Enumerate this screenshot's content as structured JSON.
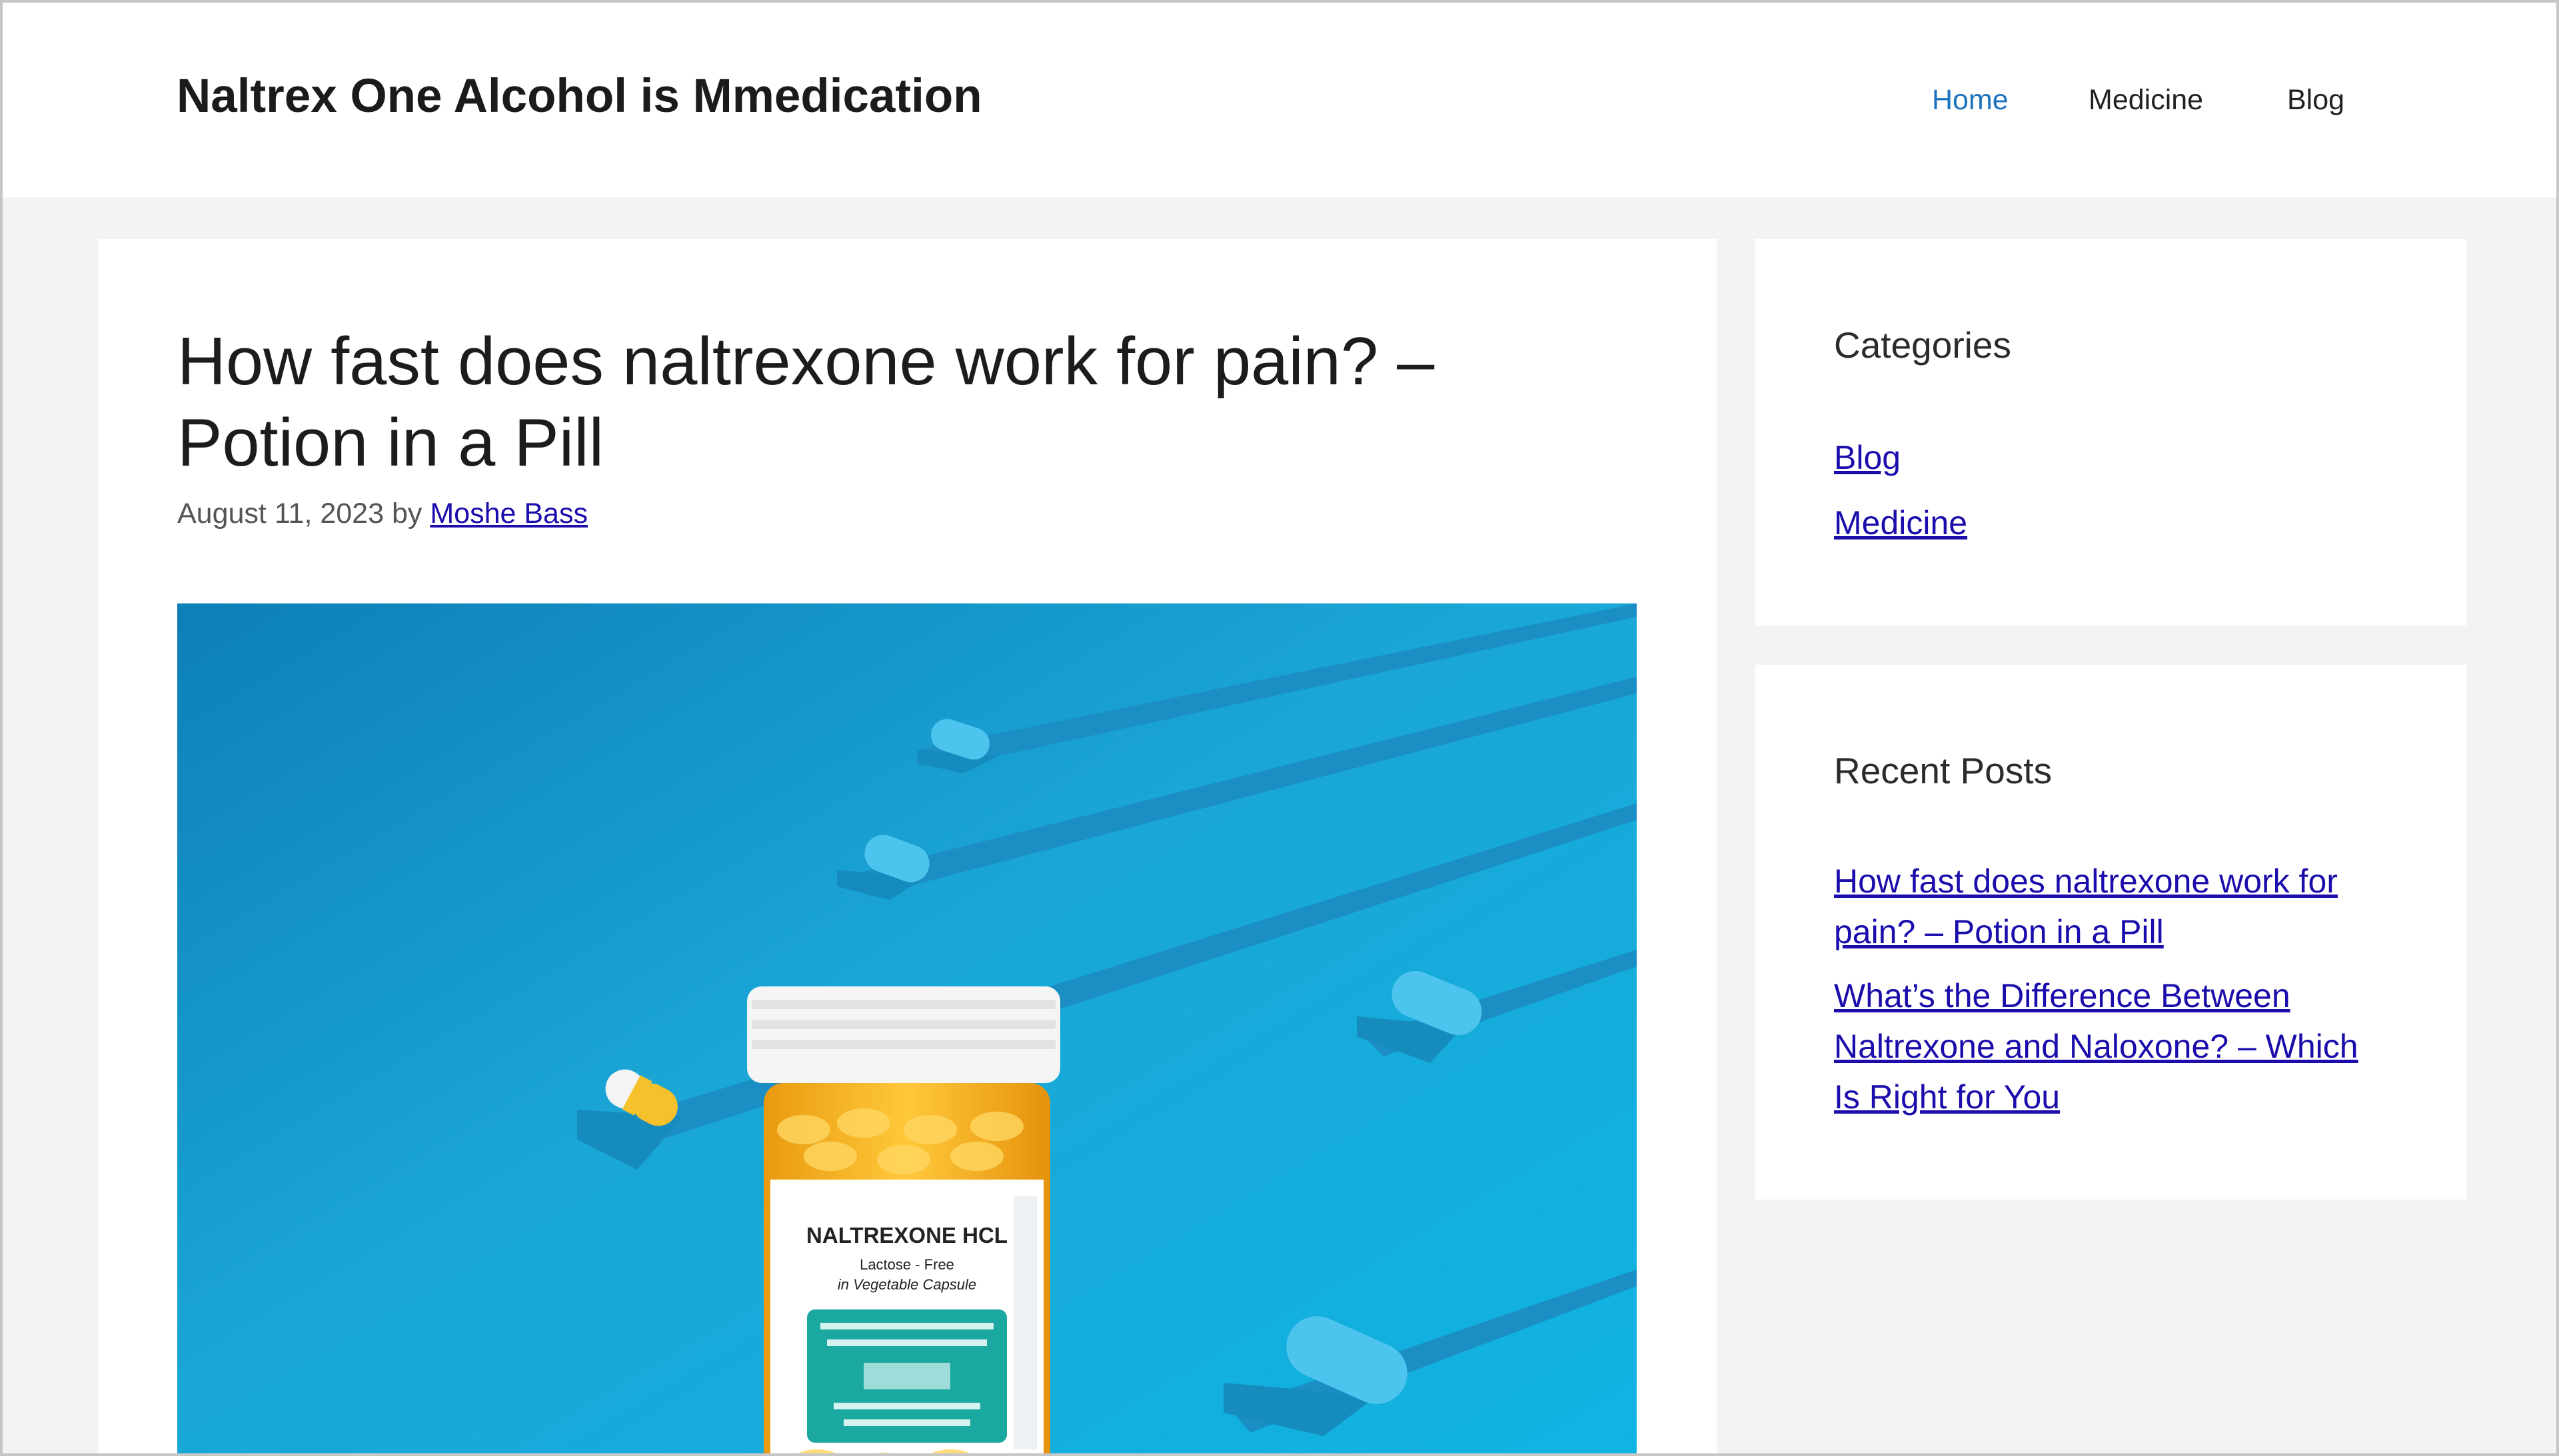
{
  "site": {
    "title": "Naltrex One Alcohol is Mmedication"
  },
  "nav": {
    "items": [
      {
        "label": "Home",
        "active": true
      },
      {
        "label": "Medicine",
        "active": false
      },
      {
        "label": "Blog",
        "active": false
      }
    ]
  },
  "post": {
    "title": "How fast does naltrexone work for pain? – Potion in a Pill",
    "date": "August 11, 2023",
    "by": "by",
    "author": "Moshe Bass",
    "image": {
      "bottle_label_line1": "NALTREXONE HCL",
      "bottle_label_line2": "Lactose - Free",
      "bottle_label_line3": "in Vegetable Capsule"
    }
  },
  "sidebar": {
    "categories": {
      "title": "Categories",
      "items": [
        "Blog",
        "Medicine"
      ]
    },
    "recent_posts": {
      "title": "Recent Posts",
      "items": [
        "How fast does naltrexone work for pain? – Potion in a Pill",
        "What’s the Difference Between Naltrexone and Naloxone? – Which Is Right for You"
      ]
    }
  },
  "colors": {
    "link": "#1a0dab",
    "nav_active": "#1e73be",
    "background": "#f1f3f5",
    "image_blue": "#1aa6d6"
  }
}
